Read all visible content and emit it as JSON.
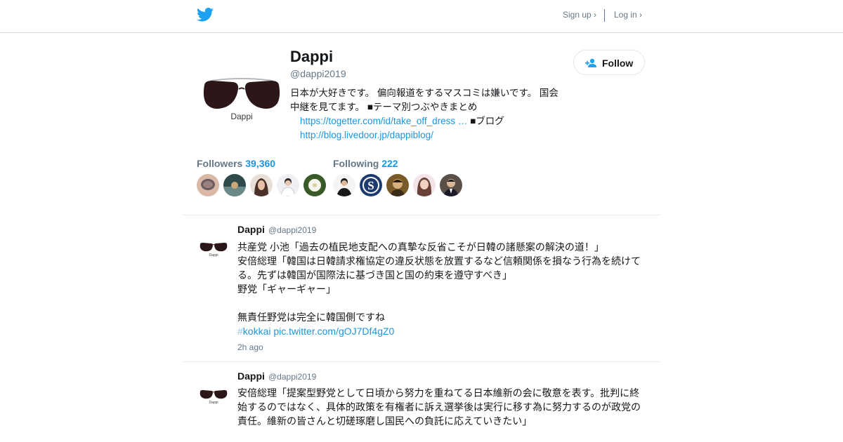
{
  "header": {
    "signup_label": "Sign up ›",
    "login_label": "Log in ›"
  },
  "profile": {
    "name": "Dappi",
    "handle": "@dappi2019",
    "avatar_text": "Dappi",
    "bio_text": "日本が大好きです。 偏向報道をするマスコミは嫌いです。 国会中継を見てます。 ■テーマ別つぶやきまとめ",
    "bio_link1": "https://togetter.com/id/take_off_dress …",
    "bio_text2": " ■ブログ",
    "bio_link2": "http://blog.livedoor.jp/dappiblog/",
    "follow_label": "Follow"
  },
  "stats": {
    "followers_label": "Followers",
    "followers_count": "39,360",
    "following_label": "Following",
    "following_count": "222"
  },
  "tweets": [
    {
      "name": "Dappi",
      "handle": "@dappi2019",
      "avatar_text": "Dappi",
      "text": "共産党 小池「過去の植民地支配への真摯な反省こそが日韓の諸懸案の解決の道！」\n安倍総理「韓国は日韓請求権協定の違反状態を放置するなど信頼関係を損なう行為を続けてる。先ずは韓国が国際法に基づき国と国の約束を遵守すべき」\n野党「ギャーギャー」\n\n無責任野党は完全に韓国側ですね",
      "hash": "#",
      "hashtag": "kokkai",
      "pic": "pic.twitter.com/gOJ7Df4gZ0",
      "time": "2h ago"
    },
    {
      "name": "Dappi",
      "handle": "@dappi2019",
      "avatar_text": "Dappi",
      "text": "安倍総理「提案型野党として日頃から努力を重ねてる日本維新の会に敬意を表す。批判に終始するのではなく、具体的政策を有権者に訴え選挙後は実行に移す為に努力するのが政党の責任。維新の皆さんと切磋琢磨し国民への負託に応えていきたい」"
    }
  ],
  "colors": {
    "accent": "#1b95e0",
    "muted": "#657786",
    "text": "#14171a",
    "divider": "#e6ecf0"
  },
  "icons": [
    "twitter-bird-icon",
    "add-person-icon"
  ]
}
